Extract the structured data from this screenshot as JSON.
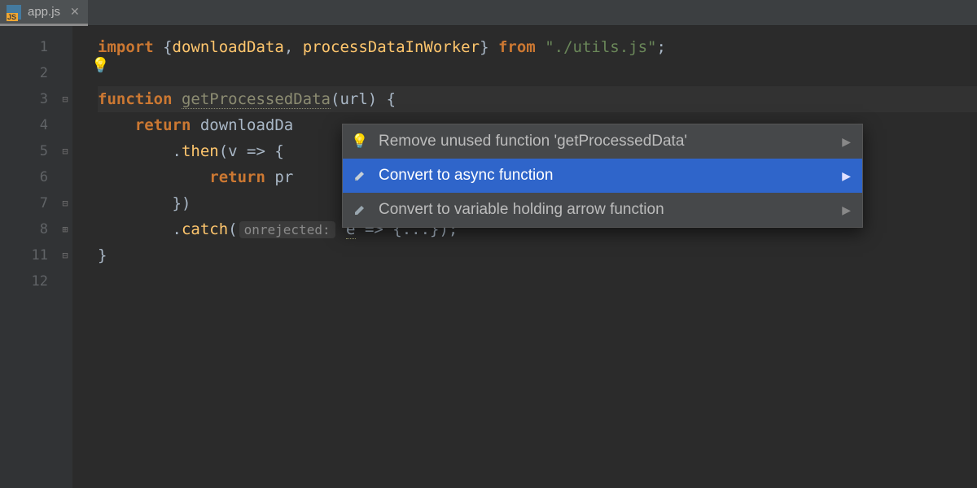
{
  "tab": {
    "filename": "app.js",
    "icon": "JS"
  },
  "gutter": {
    "lines": [
      "1",
      "2",
      "3",
      "4",
      "5",
      "6",
      "7",
      "8",
      "11",
      "12"
    ]
  },
  "code": {
    "l1": {
      "import": "import",
      "lbrace": "{",
      "d1": "downloadData",
      "comma": ", ",
      "d2": "processDataInWorker",
      "rbrace": "}",
      "from": "from",
      "path": "\"./utils.js\"",
      "semi": ";"
    },
    "l3": {
      "function": "function",
      "name": "getProcessedData",
      "params": "(url) {"
    },
    "l4": {
      "return": "return",
      "call": "downloadDa"
    },
    "l5": {
      "dot": ".",
      "then": "then",
      "rest": "(v => {"
    },
    "l6": {
      "return": "return",
      "call": "pr"
    },
    "l7": {
      "text": "})"
    },
    "l8": {
      "dot": ".",
      "catch": "catch",
      "open": "(",
      "hint": "onrejected:",
      "e": "e",
      "rest": " => {...});"
    },
    "l9": {
      "text": "}"
    }
  },
  "popup": {
    "items": [
      {
        "icon": "bulb",
        "label": "Remove unused function 'getProcessedData'",
        "selected": false
      },
      {
        "icon": "pencil",
        "label": "Convert to async function",
        "selected": true
      },
      {
        "icon": "pencil",
        "label": "Convert to variable holding arrow function",
        "selected": false
      }
    ]
  }
}
